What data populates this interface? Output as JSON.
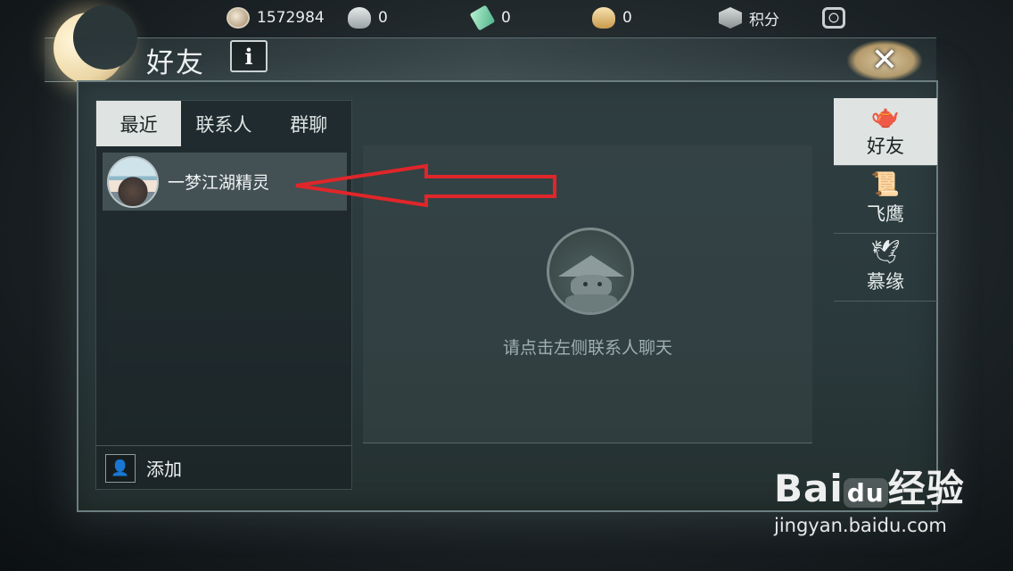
{
  "currency_bar": {
    "items": [
      {
        "icon": "silver-coin-icon",
        "value": "1572984"
      },
      {
        "icon": "silver-ingot-icon",
        "value": "0"
      },
      {
        "icon": "jade-add-icon",
        "value": "0"
      },
      {
        "icon": "gold-ingot-icon",
        "value": "0"
      },
      {
        "icon": "badge-icon",
        "value": "积分"
      },
      {
        "icon": "settings-icon",
        "value": ""
      }
    ]
  },
  "window": {
    "title": "好友",
    "info_label": "i",
    "close_label": "✕"
  },
  "tabs": [
    {
      "label": "最近",
      "active": true
    },
    {
      "label": "联系人",
      "active": false
    },
    {
      "label": "群聊",
      "active": false
    }
  ],
  "contacts": [
    {
      "name": "一梦江湖精灵"
    }
  ],
  "add": {
    "label": "添加"
  },
  "chat": {
    "hint": "请点击左侧联系人聊天"
  },
  "side_nav": [
    {
      "label": "好友",
      "icon": "teapot-icon",
      "active": true
    },
    {
      "label": "飞鹰",
      "icon": "scroll-icon",
      "active": false
    },
    {
      "label": "慕缘",
      "icon": "paper-crane-icon",
      "active": false
    }
  ],
  "annotation": {
    "color": "#e0262a"
  },
  "watermark": {
    "logo": "Bai",
    "logo_du": "du",
    "logo_suffix": "经验",
    "url": "jingyan.baidu.com"
  }
}
